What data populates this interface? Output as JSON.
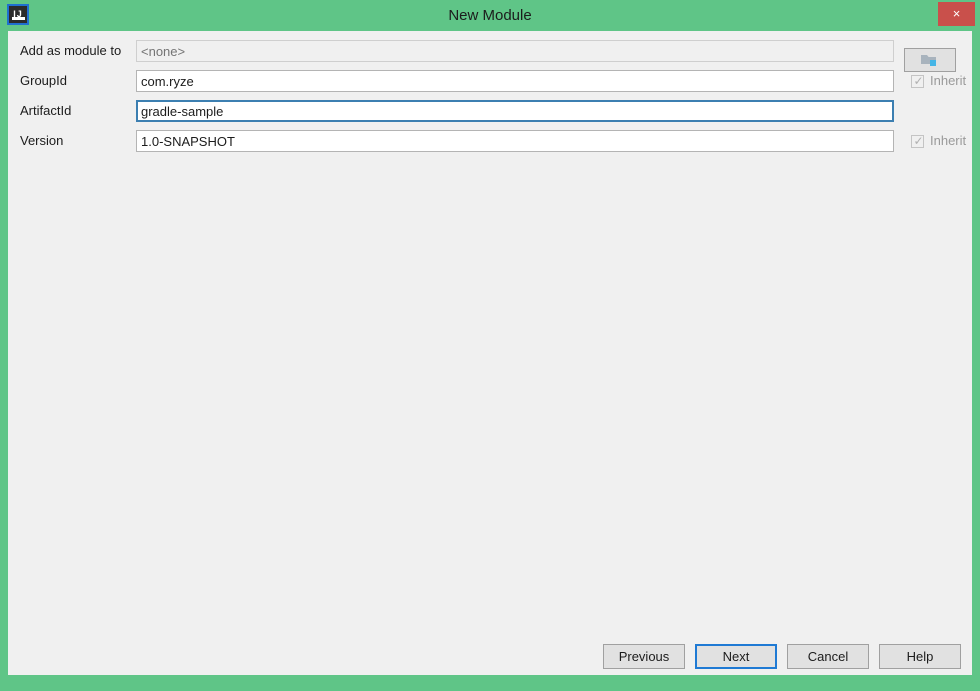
{
  "window": {
    "title": "New Module",
    "app_icon": "intellij-idea-icon",
    "icon_letters": "IJ",
    "close_label": "×",
    "titlebar_color": "#5fc587",
    "close_button_color": "#c9504b",
    "content_background": "#f0f0f0",
    "focus_color": "#1f7ad4"
  },
  "form": {
    "rows": [
      {
        "label": "Add as module to",
        "value": "",
        "placeholder": "<none>",
        "disabled": true,
        "focused": false,
        "has_browse_button": true,
        "has_inherit": false
      },
      {
        "label": "GroupId",
        "value": "com.ryze",
        "placeholder": "",
        "disabled": false,
        "focused": false,
        "has_browse_button": false,
        "has_inherit": true
      },
      {
        "label": "ArtifactId",
        "value": "gradle-sample",
        "placeholder": "",
        "disabled": false,
        "focused": true,
        "has_browse_button": false,
        "has_inherit": false
      },
      {
        "label": "Version",
        "value": "1.0-SNAPSHOT",
        "placeholder": "",
        "disabled": false,
        "focused": false,
        "has_browse_button": false,
        "has_inherit": true
      }
    ],
    "inherit_label": "Inherit",
    "inherit_checked": true,
    "inherit_enabled": false,
    "browse_icon": "folder-browse-icon"
  },
  "buttons": [
    {
      "label": "Previous",
      "default": false
    },
    {
      "label": "Next",
      "default": true
    },
    {
      "label": "Cancel",
      "default": false
    },
    {
      "label": "Help",
      "default": false
    }
  ]
}
